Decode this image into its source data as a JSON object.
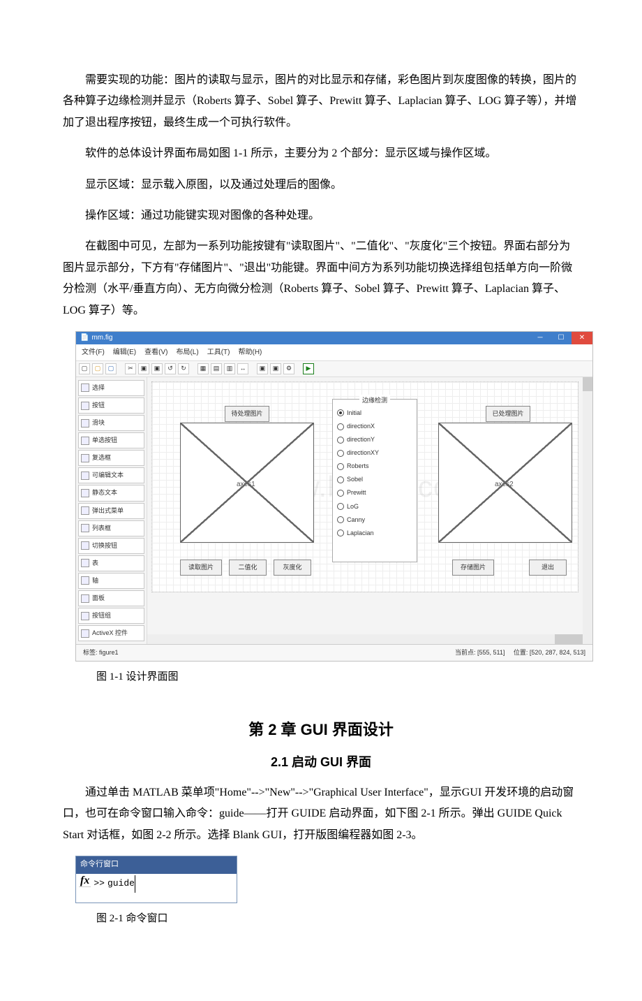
{
  "paragraphs": {
    "p1": "需要实现的功能：图片的读取与显示，图片的对比显示和存储，彩色图片到灰度图像的转换，图片的各种算子边缘检测并显示（Roberts 算子、Sobel 算子、Prewitt 算子、Laplacian 算子、LOG 算子等），并增加了退出程序按钮，最终生成一个可执行软件。",
    "p2": "软件的总体设计界面布局如图 1-1 所示，主要分为 2 个部分：显示区域与操作区域。",
    "p3": "显示区域：显示载入原图，以及通过处理后的图像。",
    "p4": "操作区域：通过功能键实现对图像的各种处理。",
    "p5": "在截图中可见，左部为一系列功能按键有\"读取图片\"、\"二值化\"、\"灰度化\"三个按钮。界面右部分为图片显示部分，下方有\"存储图片\"、\"退出\"功能键。界面中间方为系列功能切换选择组包括单方向一阶微分检测（水平/垂直方向）、无方向微分检测（Roberts 算子、Sobel 算子、Prewitt 算子、Laplacian 算子、LOG 算子）等。",
    "caption1": "图 1-1 设计界面图",
    "chapter2": "第 2 章 GUI 界面设计",
    "section21": "2.1 启动 GUI 界面",
    "p6": "通过单击 MATLAB 菜单项\"Home\"-->\"New\"-->\"Graphical User Interface\"，显示GUI 开发环境的启动窗口，也可在命令窗口输入命令：guide——打开 GUIDE 启动界面，如下图 2-1 所示。弹出 GUIDE Quick Start 对话框，如图 2-2 所示。选择 Blank GUI，打开版图编程器如图 2-3。",
    "caption2": "图 2-1 命令窗口"
  },
  "guide": {
    "title_icon": "📄",
    "title": "mm.fig",
    "win_min": "─",
    "win_max": "☐",
    "win_close": "✕",
    "menu": [
      "文件(F)",
      "编辑(E)",
      "查看(V)",
      "布局(L)",
      "工具(T)",
      "帮助(H)"
    ],
    "palette": [
      "选择",
      "按钮",
      "滑块",
      "单选按钮",
      "复选框",
      "可编辑文本",
      "静态文本",
      "弹出式菜单",
      "列表框",
      "切换按钮",
      "表",
      "轴",
      "面板",
      "按钮组",
      "ActiveX 控件"
    ],
    "canvas": {
      "btn_pending": "待处理图片",
      "btn_processed": "已处理图片",
      "axes1": "axes1",
      "axes2": "axes2",
      "panel_title": "边缘检测",
      "radios": [
        "Initial",
        "directionX",
        "directionY",
        "directionXY",
        "Roberts",
        "Sobel",
        "Prewitt",
        "LoG",
        "Canny",
        "Laplacian"
      ],
      "btn_read": "读取图片",
      "btn_bin": "二值化",
      "btn_gray": "灰度化",
      "btn_save": "存储图片",
      "btn_exit": "退出"
    },
    "status": {
      "tag": "标签: figure1",
      "point": "当前点: [555, 511]",
      "pos": "位置: [520, 287, 824, 513]"
    },
    "watermark": "www.bdocx.com"
  },
  "cmd": {
    "title": "命令行窗口",
    "fx": "fx",
    "prompt": ">>",
    "text": "guide"
  }
}
